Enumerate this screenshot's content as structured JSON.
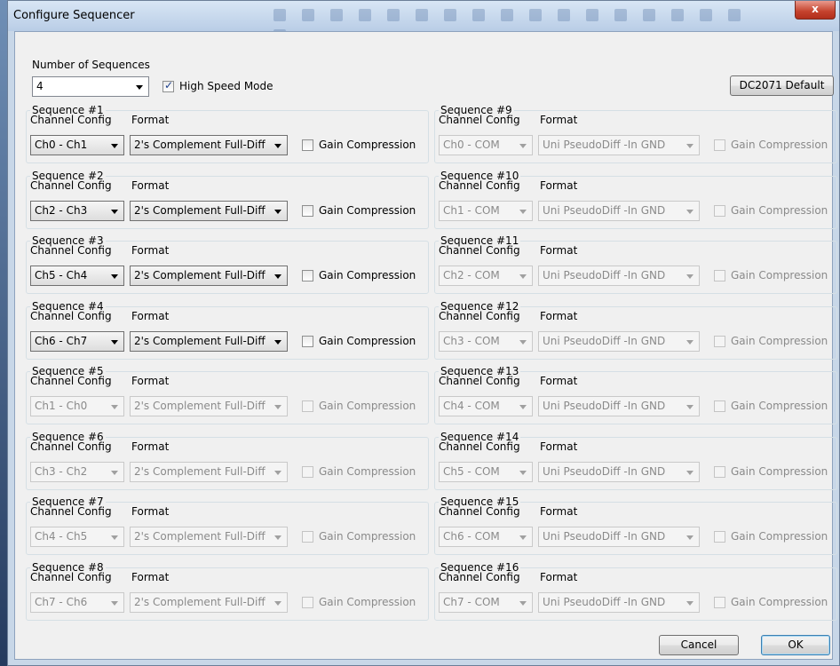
{
  "window": {
    "title": "Configure Sequencer",
    "close_label": "x"
  },
  "top": {
    "num_sequences_label": "Number of Sequences",
    "num_sequences_value": "4",
    "high_speed_label": "High Speed Mode",
    "high_speed_checked": true,
    "default_button": "DC2071 Default"
  },
  "labels": {
    "channel_config": "Channel Config",
    "format": "Format",
    "gain_compression": "Gain Compression"
  },
  "sequences": [
    {
      "title": "Sequence #1",
      "channel": "Ch0 - Ch1",
      "format": "2's Complement Full-Diff",
      "enabled": true
    },
    {
      "title": "Sequence #2",
      "channel": "Ch2 - Ch3",
      "format": "2's Complement Full-Diff",
      "enabled": true
    },
    {
      "title": "Sequence #3",
      "channel": "Ch5 - Ch4",
      "format": "2's Complement Full-Diff",
      "enabled": true
    },
    {
      "title": "Sequence #4",
      "channel": "Ch6 - Ch7",
      "format": "2's Complement Full-Diff",
      "enabled": true
    },
    {
      "title": "Sequence #5",
      "channel": "Ch1 - Ch0",
      "format": "2's Complement Full-Diff",
      "enabled": false
    },
    {
      "title": "Sequence #6",
      "channel": "Ch3 - Ch2",
      "format": "2's Complement Full-Diff",
      "enabled": false
    },
    {
      "title": "Sequence #7",
      "channel": "Ch4 - Ch5",
      "format": "2's Complement Full-Diff",
      "enabled": false
    },
    {
      "title": "Sequence #8",
      "channel": "Ch7 - Ch6",
      "format": "2's Complement Full-Diff",
      "enabled": false
    },
    {
      "title": "Sequence #9",
      "channel": "Ch0 - COM",
      "format": "Uni PseudoDiff -In GND",
      "enabled": false
    },
    {
      "title": "Sequence #10",
      "channel": "Ch1 - COM",
      "format": "Uni PseudoDiff -In GND",
      "enabled": false
    },
    {
      "title": "Sequence #11",
      "channel": "Ch2 - COM",
      "format": "Uni PseudoDiff -In GND",
      "enabled": false
    },
    {
      "title": "Sequence #12",
      "channel": "Ch3 - COM",
      "format": "Uni PseudoDiff -In GND",
      "enabled": false
    },
    {
      "title": "Sequence #13",
      "channel": "Ch4 - COM",
      "format": "Uni PseudoDiff -In GND",
      "enabled": false
    },
    {
      "title": "Sequence #14",
      "channel": "Ch5 - COM",
      "format": "Uni PseudoDiff -In GND",
      "enabled": false
    },
    {
      "title": "Sequence #15",
      "channel": "Ch6 - COM",
      "format": "Uni PseudoDiff -In GND",
      "enabled": false
    },
    {
      "title": "Sequence #16",
      "channel": "Ch7 - COM",
      "format": "Uni PseudoDiff -In GND",
      "enabled": false
    }
  ],
  "buttons": {
    "cancel": "Cancel",
    "ok": "OK"
  }
}
